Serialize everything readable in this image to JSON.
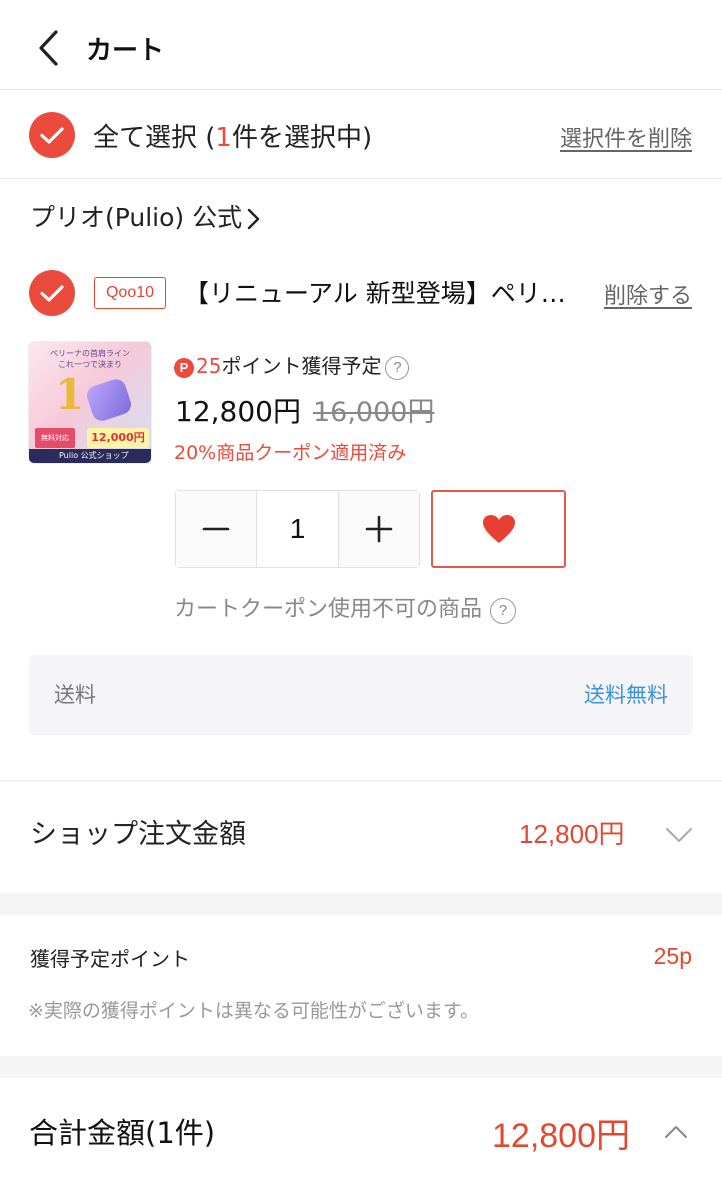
{
  "header": {
    "title": "カート",
    "back_icon": "chevron-left-icon"
  },
  "select_all": {
    "label_prefix": "全て選択 (",
    "count": "1",
    "label_suffix": "件を選択中)",
    "delete_selected_label": "選択件を削除",
    "checked": true
  },
  "shop": {
    "name": "プリオ(Pulio) 公式"
  },
  "item": {
    "checked": true,
    "badge": "Qoo10",
    "title": "【リニューアル 新型登場】ペリーナ V-ライン 公式 リフトアップ EMS",
    "delete_label": "削除する",
    "thumbnail": {
      "line1": "ペリーナの首肩ライン",
      "line2": "これ一つで決まり",
      "price": "12,000円~",
      "free": "無料対応",
      "shop_bar": "Pulio 公式ショップ",
      "big_number": "1"
    },
    "points_icon": "P",
    "points_amount": "25",
    "points_label": "ポイント獲得予定",
    "help_icon": "?",
    "price": "12,800円",
    "original_price": "16,000円",
    "coupon_applied": "20%商品クーポン適用済み",
    "quantity": "1",
    "cart_coupon_note": "カートクーポン使用不可の商品"
  },
  "shipping": {
    "label": "送料",
    "value": "送料無料"
  },
  "shop_total": {
    "label": "ショップ注文金額",
    "value": "12,800円"
  },
  "points_section": {
    "title": "獲得予定ポイント",
    "value": "25p",
    "note": "※実際の獲得ポイントは異なる可能性がございます。"
  },
  "grand_total": {
    "label": "合計金額(1件)",
    "value": "12,800円"
  },
  "colors": {
    "accent": "#ea4b3c",
    "link_blue": "#3a93d8",
    "muted": "#888888"
  }
}
